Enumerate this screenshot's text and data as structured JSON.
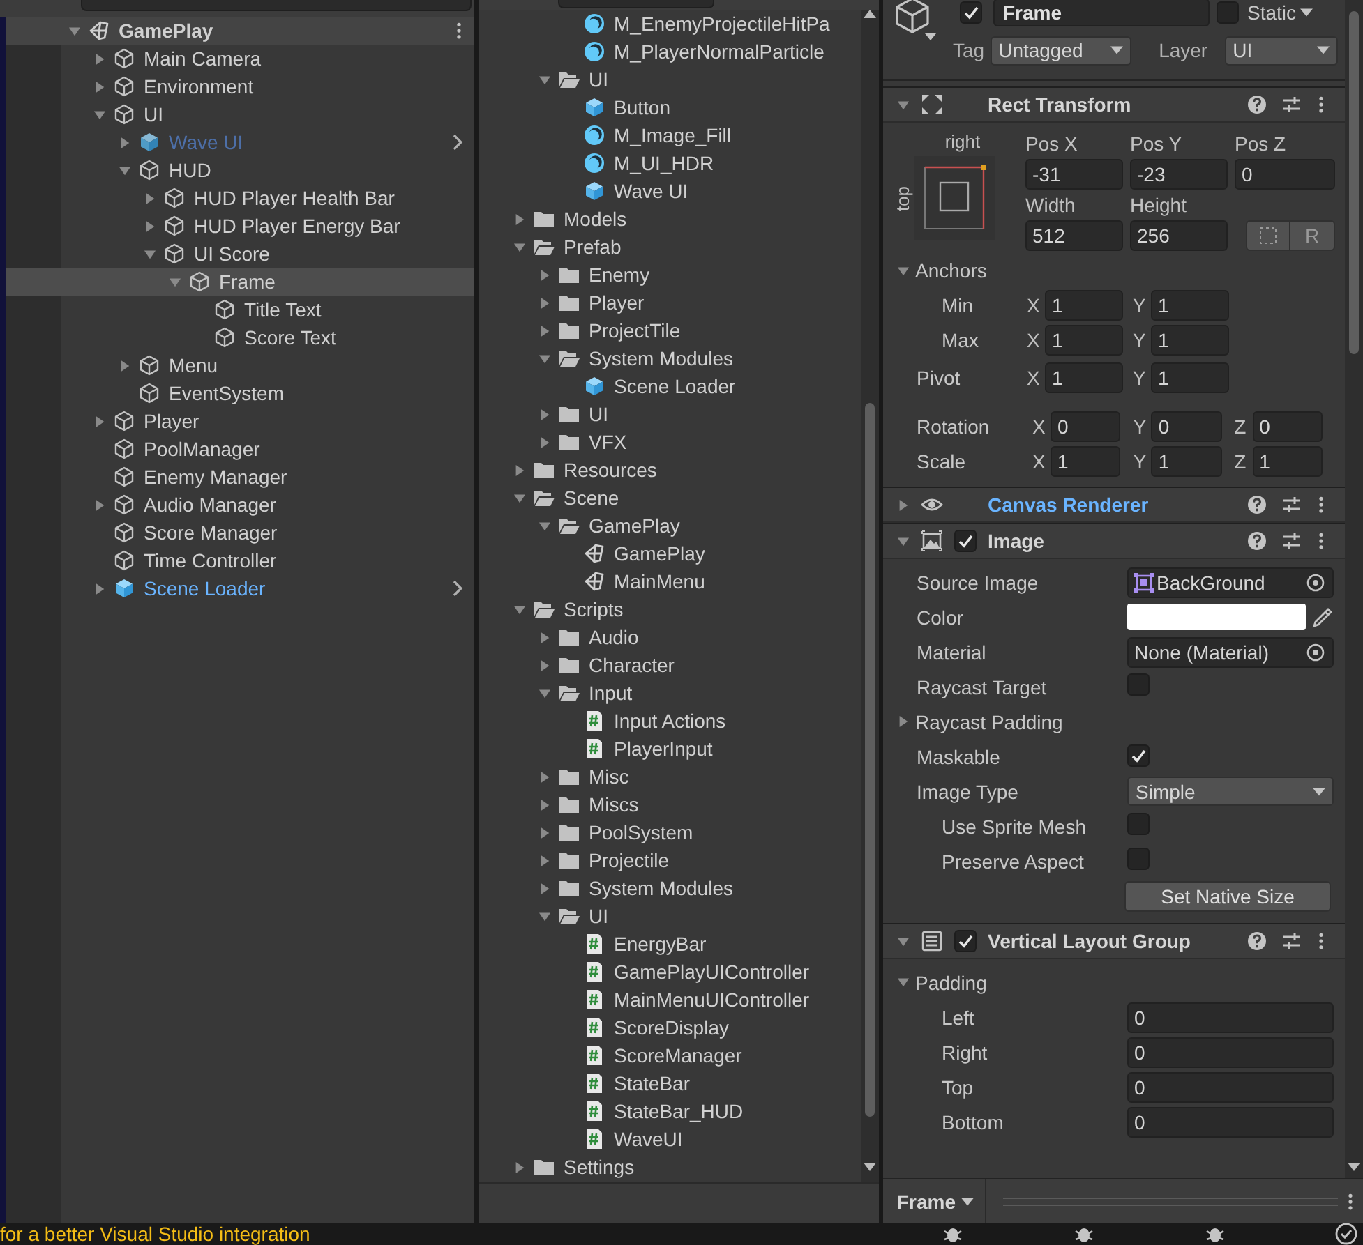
{
  "hierarchy": {
    "items": [
      {
        "label": "GamePlay",
        "kind": "scene",
        "expanded": true,
        "selected": false,
        "active": true,
        "children": [
          {
            "label": "Main Camera",
            "kind": "object",
            "expanded": false,
            "selected": false,
            "active": true
          },
          {
            "label": "Environment",
            "kind": "object",
            "expanded": false,
            "selected": false,
            "active": true
          },
          {
            "label": "UI",
            "kind": "object",
            "expanded": true,
            "selected": false,
            "active": true,
            "children": [
              {
                "label": "Wave UI",
                "kind": "prefab",
                "expanded": false,
                "selected": false,
                "active": false
              },
              {
                "label": "HUD",
                "kind": "object",
                "expanded": true,
                "selected": false,
                "active": true,
                "children": [
                  {
                    "label": "HUD Player Health Bar",
                    "kind": "object",
                    "expanded": false,
                    "selected": false,
                    "active": true
                  },
                  {
                    "label": "HUD Player Energy Bar",
                    "kind": "object",
                    "expanded": false,
                    "selected": false,
                    "active": true
                  },
                  {
                    "label": "UI Score",
                    "kind": "object",
                    "expanded": true,
                    "selected": false,
                    "active": true,
                    "children": [
                      {
                        "label": "Frame",
                        "kind": "object",
                        "expanded": true,
                        "selected": true,
                        "active": true,
                        "children": [
                          {
                            "label": "Title Text",
                            "kind": "object",
                            "selected": false,
                            "active": true
                          },
                          {
                            "label": "Score Text",
                            "kind": "object",
                            "selected": false,
                            "active": true
                          }
                        ]
                      }
                    ]
                  }
                ]
              },
              {
                "label": "Menu",
                "kind": "object",
                "expanded": false,
                "selected": false,
                "active": true
              },
              {
                "label": "EventSystem",
                "kind": "object",
                "selected": false,
                "active": true
              }
            ]
          },
          {
            "label": "Player",
            "kind": "object",
            "expanded": false,
            "selected": false,
            "active": true
          },
          {
            "label": "PoolManager",
            "kind": "object",
            "selected": false,
            "active": true
          },
          {
            "label": "Enemy Manager",
            "kind": "object",
            "selected": false,
            "active": true
          },
          {
            "label": "Audio Manager",
            "kind": "object",
            "expanded": false,
            "selected": false,
            "active": true
          },
          {
            "label": "Score Manager",
            "kind": "object",
            "selected": false,
            "active": true
          },
          {
            "label": "Time Controller",
            "kind": "object",
            "selected": false,
            "active": true
          },
          {
            "label": "Scene Loader",
            "kind": "prefab",
            "expanded": false,
            "selected": false,
            "active": true
          }
        ]
      }
    ]
  },
  "project": {
    "items": [
      {
        "children": [
          {
            "children": [
              {
                "label": "M_EnemyProjectileHitPa",
                "kind": "material"
              },
              {
                "label": "M_PlayerNormalParticle",
                "kind": "material"
              }
            ]
          },
          {
            "label": "UI",
            "kind": "folder",
            "expanded": true,
            "children": [
              {
                "label": "Button",
                "kind": "prefab"
              },
              {
                "label": "M_Image_Fill",
                "kind": "material"
              },
              {
                "label": "M_UI_HDR",
                "kind": "material"
              },
              {
                "label": "Wave UI",
                "kind": "prefab"
              }
            ]
          }
        ]
      },
      {
        "label": "Models",
        "kind": "folder",
        "expanded": false
      },
      {
        "label": "Prefab",
        "kind": "folder",
        "expanded": true,
        "children": [
          {
            "label": "Enemy",
            "kind": "folder",
            "expanded": false
          },
          {
            "label": "Player",
            "kind": "folder",
            "expanded": false
          },
          {
            "label": "ProjectTile",
            "kind": "folder",
            "expanded": false
          },
          {
            "label": "System Modules",
            "kind": "folder",
            "expanded": true,
            "children": [
              {
                "label": "Scene Loader",
                "kind": "prefab"
              }
            ]
          },
          {
            "label": "UI",
            "kind": "folder",
            "expanded": false
          },
          {
            "label": "VFX",
            "kind": "folder",
            "expanded": false
          }
        ]
      },
      {
        "label": "Resources",
        "kind": "folder",
        "expanded": false
      },
      {
        "label": "Scene",
        "kind": "folder",
        "expanded": true,
        "children": [
          {
            "label": "GamePlay",
            "kind": "folder",
            "expanded": true,
            "children": [
              {
                "label": "GamePlay",
                "kind": "scene"
              },
              {
                "label": "MainMenu",
                "kind": "scene"
              }
            ]
          }
        ]
      },
      {
        "label": "Scripts",
        "kind": "folder",
        "expanded": true,
        "children": [
          {
            "label": "Audio",
            "kind": "folder",
            "expanded": false
          },
          {
            "label": "Character",
            "kind": "folder",
            "expanded": false
          },
          {
            "label": "Input",
            "kind": "folder",
            "expanded": true,
            "children": [
              {
                "label": "Input Actions",
                "kind": "script"
              },
              {
                "label": "PlayerInput",
                "kind": "script"
              }
            ]
          },
          {
            "label": "Misc",
            "kind": "folder",
            "expanded": false
          },
          {
            "label": "Miscs",
            "kind": "folder",
            "expanded": false
          },
          {
            "label": "PoolSystem",
            "kind": "folder",
            "expanded": false
          },
          {
            "label": "Projectile",
            "kind": "folder",
            "expanded": false
          },
          {
            "label": "System Modules",
            "kind": "folder",
            "expanded": false
          },
          {
            "label": "UI",
            "kind": "folder",
            "expanded": true,
            "children": [
              {
                "label": "EnergyBar",
                "kind": "script"
              },
              {
                "label": "GamePlayUIController",
                "kind": "script"
              },
              {
                "label": "MainMenuUIController",
                "kind": "script"
              },
              {
                "label": "ScoreDisplay",
                "kind": "script"
              },
              {
                "label": "ScoreManager",
                "kind": "script"
              },
              {
                "label": "StateBar",
                "kind": "script"
              },
              {
                "label": "StateBar_HUD",
                "kind": "script"
              },
              {
                "label": "WaveUI",
                "kind": "script"
              }
            ]
          }
        ]
      },
      {
        "label": "Settings",
        "kind": "folder",
        "expanded": false
      }
    ]
  },
  "inspector": {
    "header": {
      "active": true,
      "name": "Frame",
      "static": false,
      "static_label": "Static",
      "tag_label": "Tag",
      "tag": "Untagged",
      "layer_label": "Layer",
      "layer": "UI"
    },
    "components": [
      {
        "kind": "rect-transform",
        "title": "Rect Transform",
        "expanded": true,
        "modified": false,
        "anchor_preset": {
          "horizontal": "right",
          "vertical": "top"
        },
        "fields": [
          {
            "label": "Pos X",
            "value": "-31"
          },
          {
            "label": "Pos Y",
            "value": "-23"
          },
          {
            "label": "Pos Z",
            "value": "0"
          },
          {
            "label": "Width",
            "value": "512"
          },
          {
            "label": "Height",
            "value": "256"
          }
        ],
        "raw_button": "R",
        "anchors": {
          "label": "Anchors",
          "expanded": true,
          "rows": [
            {
              "label": "Min",
              "axes": [
                {
                  "axis": "X",
                  "value": "1"
                },
                {
                  "axis": "Y",
                  "value": "1"
                }
              ]
            },
            {
              "label": "Max",
              "axes": [
                {
                  "axis": "X",
                  "value": "1"
                },
                {
                  "axis": "Y",
                  "value": "1"
                }
              ]
            }
          ]
        },
        "vectors": [
          {
            "label": "Pivot",
            "axes": [
              {
                "axis": "X",
                "value": "1"
              },
              {
                "axis": "Y",
                "value": "1"
              }
            ]
          },
          {
            "label": "Rotation",
            "axes": [
              {
                "axis": "X",
                "value": "0"
              },
              {
                "axis": "Y",
                "value": "0"
              },
              {
                "axis": "Z",
                "value": "0"
              }
            ]
          },
          {
            "label": "Scale",
            "axes": [
              {
                "axis": "X",
                "value": "1"
              },
              {
                "axis": "Y",
                "value": "1"
              },
              {
                "axis": "Z",
                "value": "1"
              }
            ]
          }
        ]
      },
      {
        "kind": "canvas-renderer",
        "title": "Canvas Renderer",
        "expanded": false,
        "modified": true
      },
      {
        "kind": "image",
        "title": "Image",
        "expanded": true,
        "enabled": true,
        "modified": false,
        "properties": [
          {
            "kind": "object",
            "label": "Source Image",
            "value": "BackGround",
            "sprite_icon": true
          },
          {
            "kind": "color",
            "label": "Color",
            "color": "#ffffff"
          },
          {
            "kind": "object",
            "label": "Material",
            "value": "None (Material)",
            "sprite_icon": false
          },
          {
            "kind": "checkbox",
            "label": "Raycast Target",
            "checked": false
          },
          {
            "kind": "foldout",
            "label": "Raycast Padding",
            "expanded": false
          },
          {
            "kind": "checkbox",
            "label": "Maskable",
            "checked": true
          },
          {
            "kind": "dropdown",
            "label": "Image Type",
            "value": "Simple",
            "children": [
              {
                "kind": "checkbox",
                "label": "Use Sprite Mesh",
                "checked": false
              },
              {
                "kind": "checkbox",
                "label": "Preserve Aspect",
                "checked": false
              }
            ]
          },
          {
            "kind": "button",
            "label": "Set Native Size"
          }
        ]
      },
      {
        "kind": "layout-group",
        "title": "Vertical Layout Group",
        "expanded": true,
        "enabled": true,
        "modified": false,
        "properties": [
          {
            "kind": "foldout",
            "label": "Padding",
            "expanded": true,
            "children": [
              {
                "kind": "number",
                "label": "Left",
                "value": "0"
              },
              {
                "kind": "number",
                "label": "Right",
                "value": "0"
              },
              {
                "kind": "number",
                "label": "Top",
                "value": "0"
              },
              {
                "kind": "number",
                "label": "Bottom",
                "value": "0"
              }
            ]
          }
        ]
      }
    ],
    "footer": {
      "label": "Frame"
    }
  },
  "status_bar": {
    "message": "for a better Visual Studio integration"
  }
}
